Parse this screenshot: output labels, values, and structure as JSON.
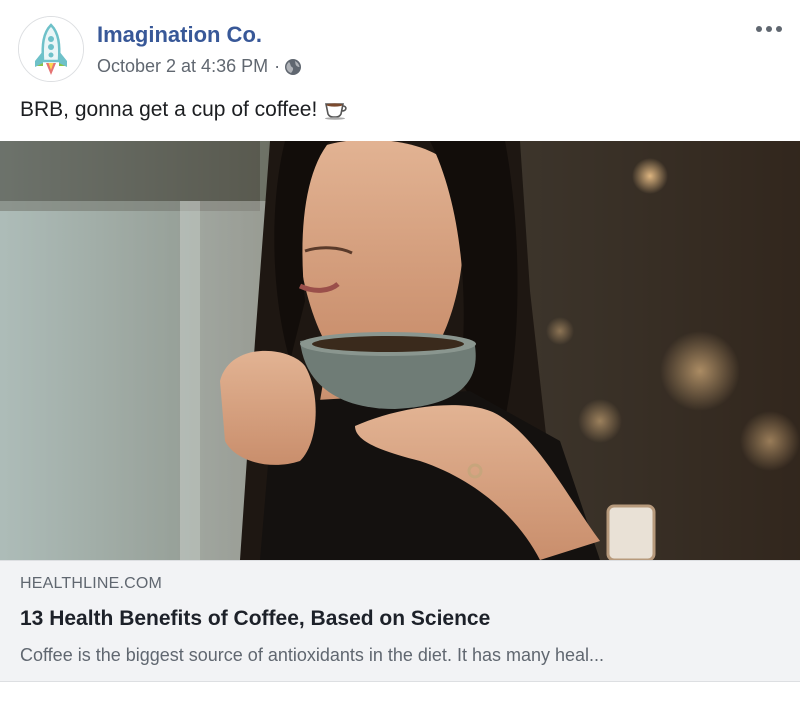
{
  "post": {
    "page_name": "Imagination Co.",
    "timestamp": "October 2 at 4:36 PM",
    "separator": "·",
    "privacy_icon": "globe-icon",
    "more_icon": "more-options-icon",
    "status_text": "BRB, gonna get a cup of coffee!",
    "status_emoji_icon": "coffee-cup-icon"
  },
  "link_preview": {
    "image_description_icon": "photo-woman-drinking-coffee",
    "domain": "HEALTHLINE.COM",
    "title": "13 Health Benefits of Coffee, Based on Science",
    "description": "Coffee is the biggest source of antioxidants in the diet. It has many heal..."
  },
  "colors": {
    "page_name": "#385898",
    "meta_text": "#606770",
    "body_text": "#1c1e21",
    "link_bg": "#f2f3f5",
    "avatar_rocket": "#6ec1c9",
    "avatar_flame": "#8bc34a"
  }
}
